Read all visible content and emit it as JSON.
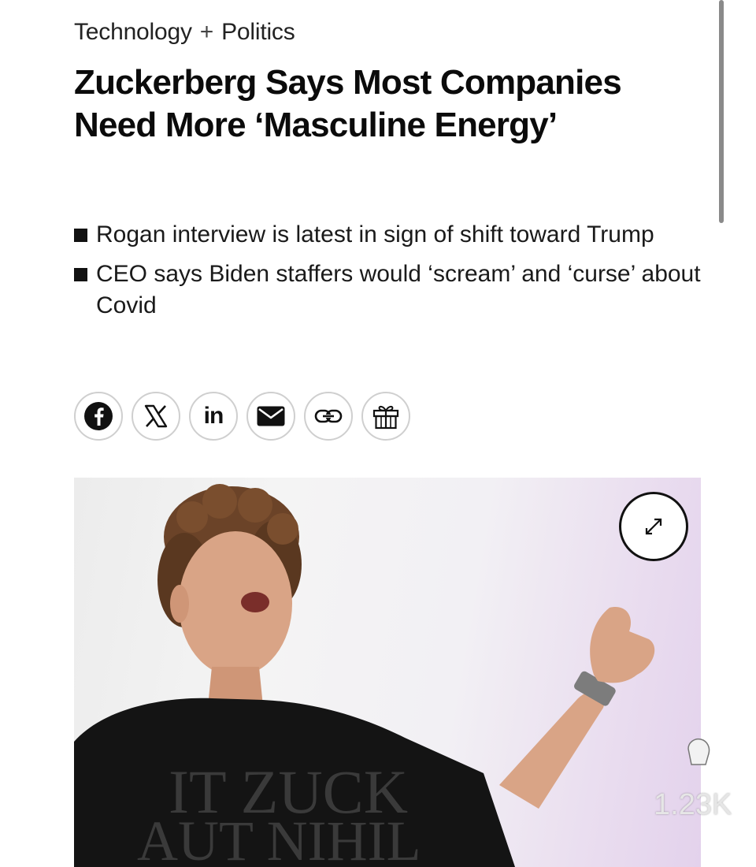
{
  "breadcrumb": {
    "section1": "Technology",
    "separator": "+",
    "section2": "Politics"
  },
  "article": {
    "headline": "Zuckerberg Says Most Companies Need More ‘Masculine Energy’",
    "bullets": [
      "Rogan interview is latest in sign of shift toward Trump",
      "CEO says Biden staffers would ‘scream’ and ‘curse’ about Covid"
    ]
  },
  "share": {
    "icons": [
      "facebook-icon",
      "x-icon",
      "linkedin-icon",
      "mail-icon",
      "link-icon",
      "gift-icon"
    ],
    "linkedin_label": "in"
  },
  "hero": {
    "shirt_text_line1": "IT  ZUCK",
    "shirt_text_line2": "AUT NIHIL"
  },
  "overlay": {
    "reaction_count": "1.23K"
  },
  "colors": {
    "text": "#111111",
    "border": "#cfcfcf",
    "background": "#ffffff"
  }
}
